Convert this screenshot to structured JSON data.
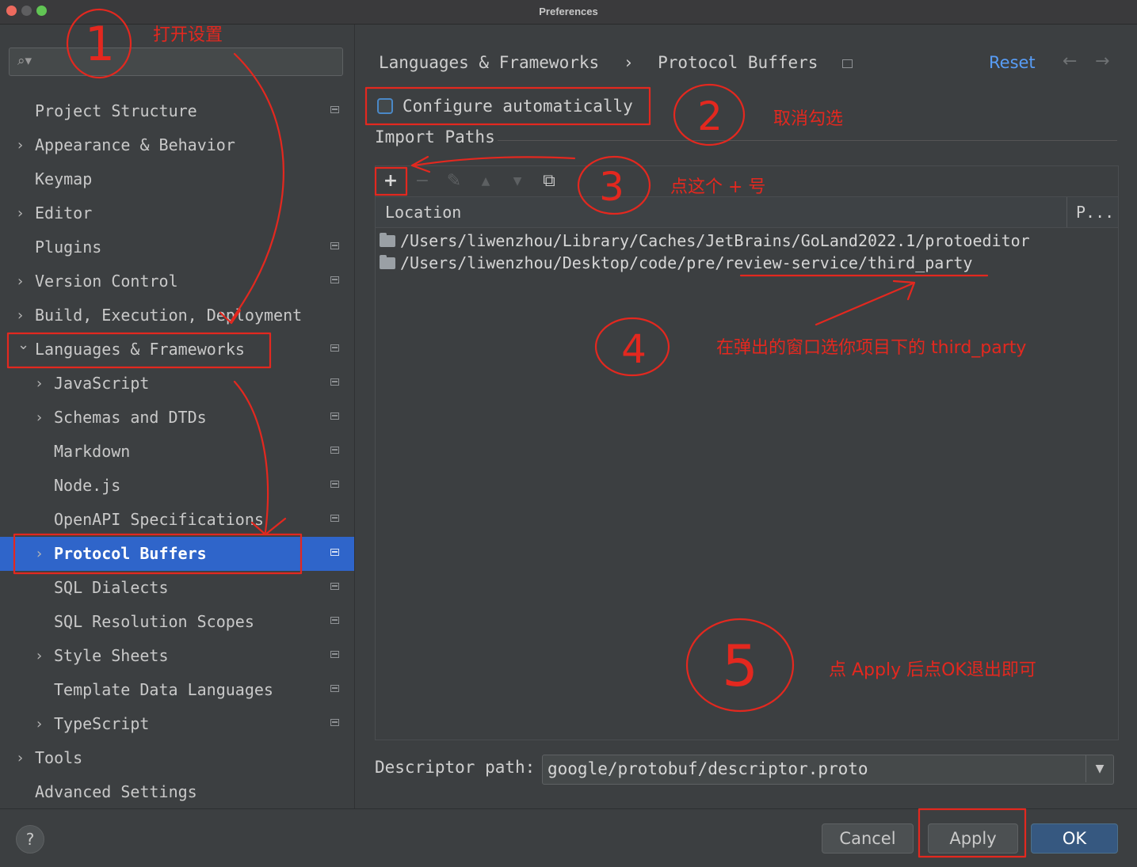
{
  "window": {
    "title": "Preferences"
  },
  "search": {
    "placeholder": ""
  },
  "sidebar": {
    "items": [
      {
        "label": "Project Structure",
        "indent": 0,
        "chevron": false,
        "project": true
      },
      {
        "label": "Appearance & Behavior",
        "indent": 0,
        "chevron": true,
        "project": false
      },
      {
        "label": "Keymap",
        "indent": 0,
        "chevron": false,
        "project": false
      },
      {
        "label": "Editor",
        "indent": 0,
        "chevron": true,
        "project": false
      },
      {
        "label": "Plugins",
        "indent": 0,
        "chevron": false,
        "project": true
      },
      {
        "label": "Version Control",
        "indent": 0,
        "chevron": true,
        "project": true
      },
      {
        "label": "Build, Execution, Deployment",
        "indent": 0,
        "chevron": true,
        "project": false
      },
      {
        "label": "Languages & Frameworks",
        "indent": 0,
        "chevron": true,
        "expanded": true,
        "project": true
      },
      {
        "label": "JavaScript",
        "indent": 1,
        "chevron": true,
        "project": true
      },
      {
        "label": "Schemas and DTDs",
        "indent": 1,
        "chevron": true,
        "project": true
      },
      {
        "label": "Markdown",
        "indent": 1,
        "chevron": false,
        "project": true
      },
      {
        "label": "Node.js",
        "indent": 1,
        "chevron": false,
        "project": true
      },
      {
        "label": "OpenAPI Specifications",
        "indent": 1,
        "chevron": false,
        "project": true
      },
      {
        "label": "Protocol Buffers",
        "indent": 1,
        "chevron": true,
        "project": true,
        "selected": true
      },
      {
        "label": "SQL Dialects",
        "indent": 1,
        "chevron": false,
        "project": true
      },
      {
        "label": "SQL Resolution Scopes",
        "indent": 1,
        "chevron": false,
        "project": true
      },
      {
        "label": "Style Sheets",
        "indent": 1,
        "chevron": true,
        "project": true
      },
      {
        "label": "Template Data Languages",
        "indent": 1,
        "chevron": false,
        "project": true
      },
      {
        "label": "TypeScript",
        "indent": 1,
        "chevron": true,
        "project": true
      },
      {
        "label": "Tools",
        "indent": 0,
        "chevron": true,
        "project": false
      },
      {
        "label": "Advanced Settings",
        "indent": 0,
        "chevron": false,
        "project": false
      }
    ]
  },
  "content": {
    "breadcrumb": [
      "Languages & Frameworks",
      "Protocol Buffers"
    ],
    "breadcrumb_sep": "›",
    "reset_label": "Reset",
    "configure_automatically": {
      "label": "Configure automatically",
      "checked": false
    },
    "import_paths_title": "Import Paths",
    "table": {
      "columns": [
        "Location",
        "P..."
      ],
      "rows": [
        "/Users/liwenzhou/Library/Caches/JetBrains/GoLand2022.1/protoeditor",
        "/Users/liwenzhou/Desktop/code/pre/review-service/third_party"
      ]
    },
    "descriptor_label": "Descriptor path:",
    "descriptor_value": "google/protobuf/descriptor.proto"
  },
  "toolbar": {
    "add": "+",
    "remove": "−",
    "edit": "✎",
    "up": "▲",
    "down": "▼",
    "copy": "⧉"
  },
  "footer": {
    "help": "?",
    "cancel": "Cancel",
    "apply": "Apply",
    "ok": "OK"
  },
  "annotations": {
    "step_labels": [
      "1",
      "2",
      "3",
      "4",
      "5"
    ],
    "note1": "打开设置",
    "note2": "取消勾选",
    "note3": "点这个 + 号",
    "note4": "在弹出的窗口选你项目下的 third_party",
    "note5": "点 Apply 后点OK退出即可"
  },
  "colors": {
    "accent": "#2f65ca",
    "link": "#589df6",
    "annotation": "#e3281f"
  }
}
